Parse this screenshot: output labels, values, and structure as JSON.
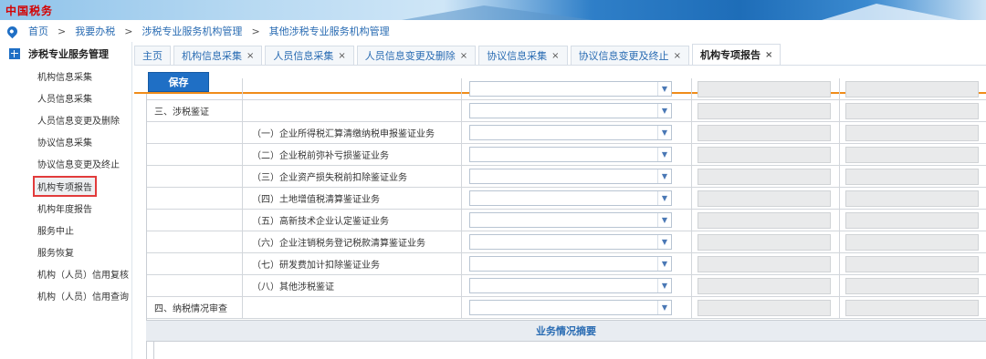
{
  "app": {
    "logo_text": "中国税务"
  },
  "breadcrumb": [
    "首页",
    "我要办税",
    "涉税专业服务机构管理",
    "其他涉税专业服务机构管理"
  ],
  "sidebar": {
    "title": "涉税专业服务管理",
    "items": [
      {
        "label": "机构信息采集"
      },
      {
        "label": "人员信息采集"
      },
      {
        "label": "人员信息变更及删除"
      },
      {
        "label": "协议信息采集"
      },
      {
        "label": "协议信息变更及终止"
      },
      {
        "label": "机构专项报告"
      },
      {
        "label": "机构年度报告"
      },
      {
        "label": "服务中止"
      },
      {
        "label": "服务恢复"
      },
      {
        "label": "机构（人员）信用复核"
      },
      {
        "label": "机构（人员）信用查询"
      }
    ]
  },
  "tabs": [
    {
      "label": "主页",
      "closable": false
    },
    {
      "label": "机构信息采集",
      "closable": true
    },
    {
      "label": "人员信息采集",
      "closable": true
    },
    {
      "label": "人员信息变更及删除",
      "closable": true
    },
    {
      "label": "协议信息采集",
      "closable": true
    },
    {
      "label": "协议信息变更及终止",
      "closable": true
    },
    {
      "label": "机构专项报告",
      "closable": true,
      "active": true
    }
  ],
  "toolbar": {
    "save_label": "保存"
  },
  "table": {
    "rows": [
      {
        "c1": "",
        "c2": ""
      },
      {
        "c1": "三、涉税鉴证",
        "c2": ""
      },
      {
        "c1": "",
        "c2": "（一）企业所得税汇算清缴纳税申报鉴证业务"
      },
      {
        "c1": "",
        "c2": "（二）企业税前弥补亏损鉴证业务"
      },
      {
        "c1": "",
        "c2": "（三）企业资产损失税前扣除鉴证业务"
      },
      {
        "c1": "",
        "c2": "（四）土地增值税清算鉴证业务"
      },
      {
        "c1": "",
        "c2": "（五）高新技术企业认定鉴证业务"
      },
      {
        "c1": "",
        "c2": "（六）企业注销税务登记税款清算鉴证业务"
      },
      {
        "c1": "",
        "c2": "（七）研发费加计扣除鉴证业务"
      },
      {
        "c1": "",
        "c2": "（八）其他涉税鉴证"
      },
      {
        "c1": "四、纳税情况审查",
        "c2": ""
      }
    ],
    "summary_title": "业务情况摘要"
  },
  "colors": {
    "accent": "#1f6fc5",
    "tab_underline": "#f08c1a",
    "highlight_box": "#e23b3b"
  }
}
